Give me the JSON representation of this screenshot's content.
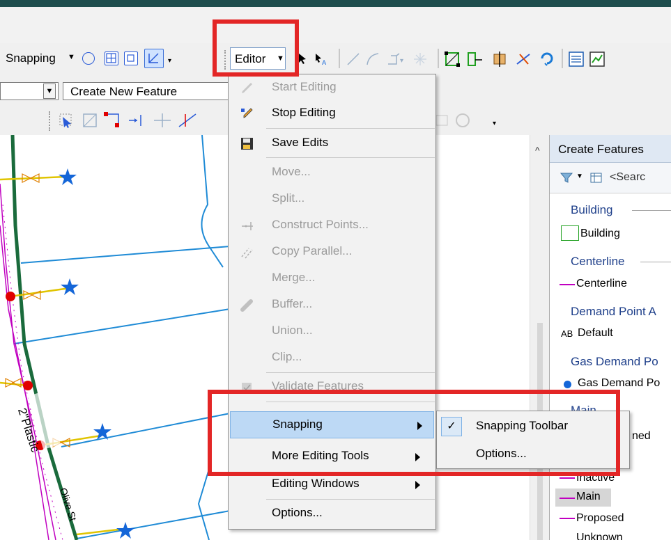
{
  "toolbar": {
    "snapping_label": "Snapping",
    "editor_label": "Editor",
    "template_combo_value": "",
    "create_combo_value": "Create New Feature"
  },
  "menu": {
    "items": [
      {
        "label": "Start Editing",
        "disabled": true
      },
      {
        "label": "Stop Editing",
        "disabled": false
      },
      {
        "label": "Save Edits",
        "disabled": false
      },
      {
        "label": "Move...",
        "disabled": true
      },
      {
        "label": "Split...",
        "disabled": true
      },
      {
        "label": "Construct Points...",
        "disabled": true
      },
      {
        "label": "Copy Parallel...",
        "disabled": true
      },
      {
        "label": "Merge...",
        "disabled": true
      },
      {
        "label": "Buffer...",
        "disabled": true
      },
      {
        "label": "Union...",
        "disabled": true
      },
      {
        "label": "Clip...",
        "disabled": true
      },
      {
        "label": "Validate Features",
        "disabled": true
      },
      {
        "label": "Snapping",
        "disabled": false,
        "submenu": true
      },
      {
        "label": "More Editing Tools",
        "disabled": false,
        "submenu": true
      },
      {
        "label": "Editing Windows",
        "disabled": false,
        "submenu": true
      },
      {
        "label": "Options...",
        "disabled": false
      }
    ]
  },
  "submenu": {
    "items": [
      {
        "label": "Snapping Toolbar",
        "checked": true
      },
      {
        "label": "Options...",
        "checked": false
      }
    ]
  },
  "create_features": {
    "title": "Create Features",
    "search_placeholder": "<Searc",
    "groups": [
      {
        "name": "Building",
        "items": [
          "Building"
        ]
      },
      {
        "name": "Centerline",
        "items": [
          "Centerline"
        ]
      },
      {
        "name": "Demand Point A",
        "items": [
          "Default"
        ]
      },
      {
        "name": "Gas Demand Po",
        "items": [
          "Gas Demand Po"
        ]
      },
      {
        "name": "Main",
        "items": [
          "ned",
          "Inactive",
          "Main",
          "Proposed",
          "Unknown"
        ]
      }
    ],
    "default_prefix": "AB"
  },
  "map": {
    "labels": [
      "2\"Plastic",
      "Olive St"
    ]
  },
  "colors": {
    "highlight_box": "#e32626",
    "main_line": "#1a6b3c",
    "parcel_line": "#1f8bd6",
    "service_line": "#e0c400",
    "purple_line": "#c000c0",
    "star": "#1466d8",
    "node": "#e00000"
  }
}
